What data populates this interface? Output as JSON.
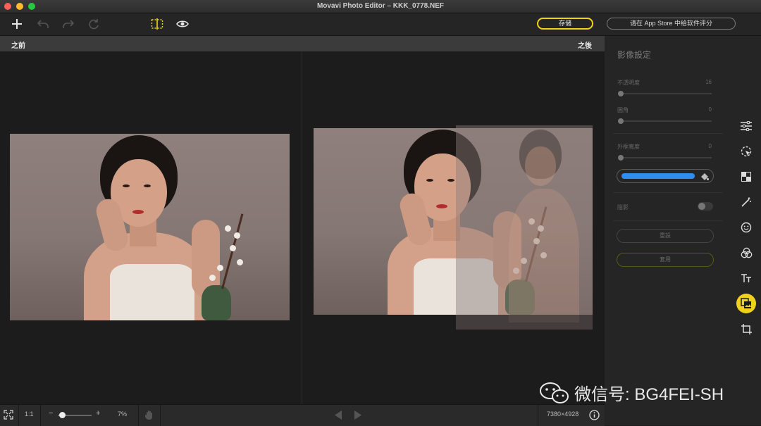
{
  "window": {
    "title": "Movavi Photo Editor – KKK_0778.NEF"
  },
  "toolbar": {
    "add_icon": "plus-icon",
    "undo_icon": "undo-icon",
    "redo_icon": "redo-icon",
    "reset_icon": "refresh-icon",
    "compare_icon": "split-compare-icon",
    "preview_icon": "eye-icon",
    "save_label": "存储",
    "rate_label": "请在 App Store 中给软件评分"
  },
  "compare": {
    "before_label": "之前",
    "after_label": "之後"
  },
  "panel": {
    "heading": "影像設定",
    "opacity_label": "不透明度",
    "opacity_value": "16",
    "corner_label": "圓角",
    "corner_value": "0",
    "border_label": "外框寬度",
    "border_value": "0",
    "border_color": "#2d8df0",
    "shadow_label": "陰影",
    "shadow_enabled": false,
    "reset_label": "重設",
    "apply_label": "套用"
  },
  "rail": {
    "items": [
      {
        "icon": "adjust-sliders-icon",
        "active": false
      },
      {
        "icon": "selection-cursor-icon",
        "active": false
      },
      {
        "icon": "background-checker-icon",
        "active": false
      },
      {
        "icon": "magic-wand-icon",
        "active": false
      },
      {
        "icon": "face-retouch-icon",
        "active": false
      },
      {
        "icon": "color-circles-icon",
        "active": false
      },
      {
        "icon": "text-tool-icon",
        "active": false
      },
      {
        "icon": "image-overlay-icon",
        "active": true
      },
      {
        "icon": "crop-icon",
        "active": false
      }
    ],
    "active_color": "#f1d21b"
  },
  "statusbar": {
    "fit_icon": "fit-screen-icon",
    "one_to_one": "1:1",
    "zoom_minus": "−",
    "zoom_plus": "+",
    "zoom_value": "7%",
    "zoom_fraction": 0.07,
    "hand_icon": "hand-icon",
    "prev_icon": "prev-arrow-icon",
    "next_icon": "next-arrow-icon",
    "dimensions": "7380×4928",
    "info_icon": "info-icon"
  },
  "watermark": {
    "icon": "wechat-icon",
    "text": "微信号: BG4FEI-SH"
  }
}
